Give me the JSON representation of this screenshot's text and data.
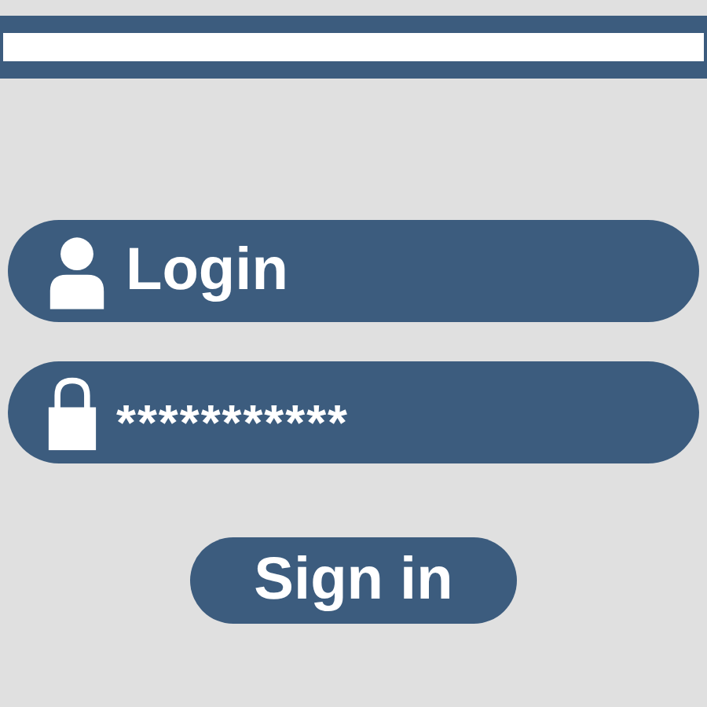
{
  "username": {
    "placeholder": "Login"
  },
  "password": {
    "value": "***********"
  },
  "button": {
    "label": "Sign in"
  }
}
